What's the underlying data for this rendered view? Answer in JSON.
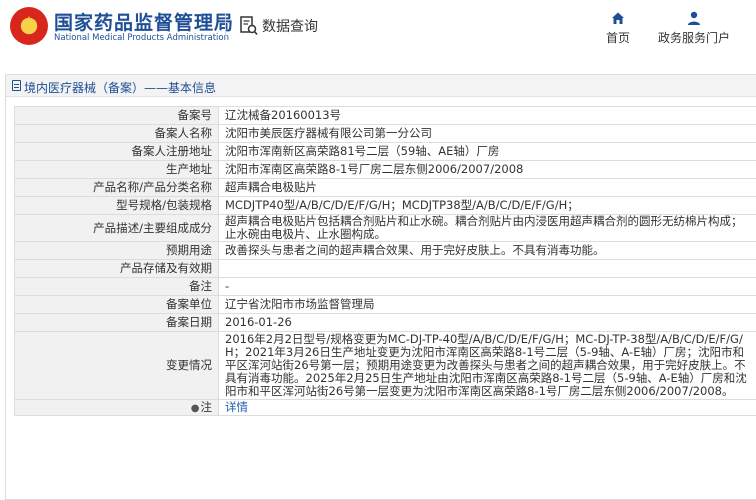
{
  "header": {
    "brand_cn": "国家药品监督管理局",
    "brand_en": "National Medical Products Administration",
    "query_label": "数据查询",
    "nav": [
      {
        "label": "首页",
        "icon": "home-icon"
      },
      {
        "label": "政务服务门户",
        "icon": "user-icon"
      }
    ]
  },
  "section": {
    "title": "境内医疗器械（备案）——基本信息"
  },
  "rows": [
    {
      "label": "备案号",
      "value": "辽沈械备20160013号"
    },
    {
      "label": "备案人名称",
      "value": "沈阳市美辰医疗器械有限公司第一分公司"
    },
    {
      "label": "备案人注册地址",
      "value": "沈阳市浑南新区高荣路81号二层（59轴、AE轴）厂房"
    },
    {
      "label": "生产地址",
      "value": "沈阳市浑南区高荣路8-1号厂房二层东侧2006/2007/2008"
    },
    {
      "label": "产品名称/产品分类名称",
      "value": "超声耦合电极贴片"
    },
    {
      "label": "型号规格/包装规格",
      "value": "MCDJTP40型/A/B/C/D/E/F/G/H；MCDJTP38型/A/B/C/D/E/F/G/H；"
    },
    {
      "label": "产品描述/主要组成成分",
      "value": "超声耦合电极贴片包括耦合剂贴片和止水碗。耦合剂贴片由内浸医用超声耦合剂的圆形无纺棉片构成；止水碗由电极片、止水圈构成。"
    },
    {
      "label": "预期用途",
      "value": "改善探头与患者之间的超声耦合效果、用于完好皮肤上。不具有消毒功能。"
    },
    {
      "label": "产品存储及有效期",
      "value": ""
    },
    {
      "label": "备注",
      "value": "-"
    },
    {
      "label": "备案单位",
      "value": "辽宁省沈阳市市场监督管理局"
    },
    {
      "label": "备案日期",
      "value": "2016-01-26"
    },
    {
      "label": "变更情况",
      "value": "2016年2月2日型号/规格变更为MC-DJ-TP-40型/A/B/C/D/E/F/G/H；MC-DJ-TP-38型/A/B/C/D/E/F/G/H；2021年3月26日生产地址变更为沈阳市浑南区高荣路8-1号二层（5-9轴、A-E轴）厂房；沈阳市和平区浑河站街26号第一层；预期用途变更为改善探头与患者之间的超声耦合效果，用于完好皮肤上。不具有消毒功能。2025年2月25日生产地址由沈阳市浑南区高荣路8-1号二层（5-9轴、A-E轴）厂房和沈阳市和平区浑河站街26号第一层变更为沈阳市浑南区高荣路8-1号厂房二层东侧2006/2007/2008。"
    },
    {
      "label": "注",
      "value": "详情"
    }
  ]
}
